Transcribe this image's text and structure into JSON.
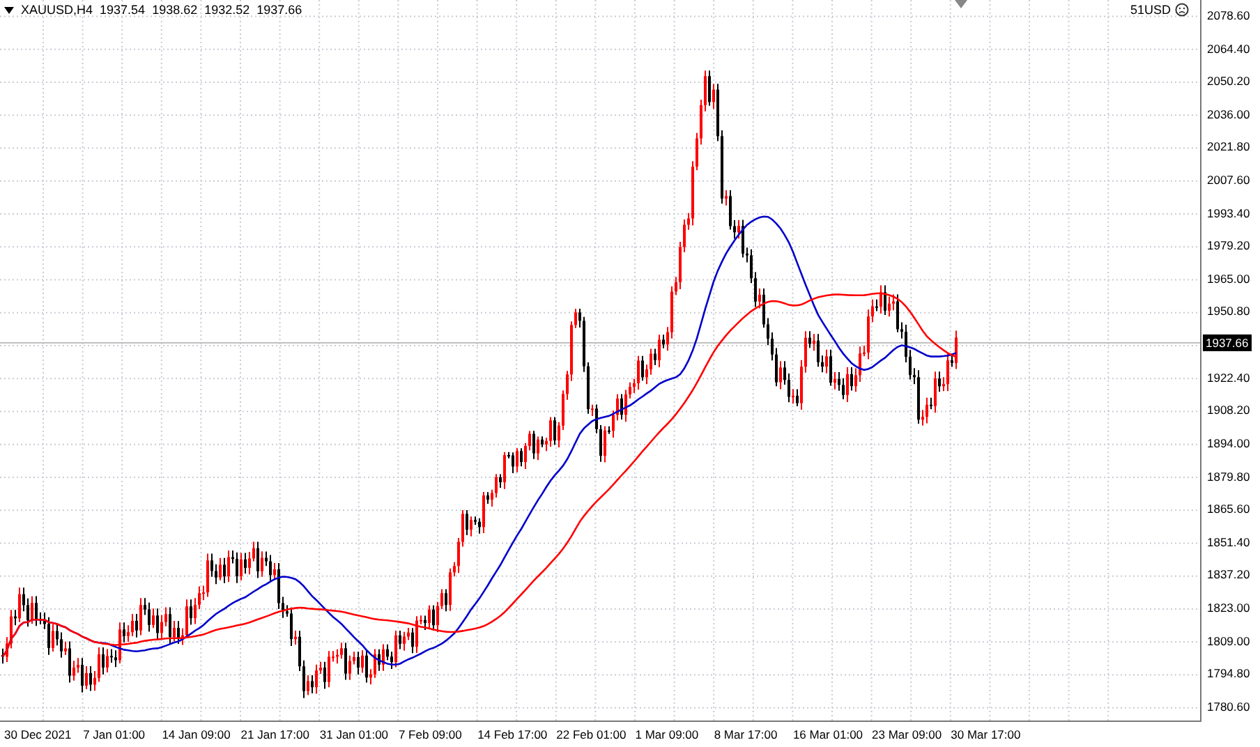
{
  "symbol": "XAUUSD,H4",
  "ohlc": [
    "1937.54",
    "1938.62",
    "1932.52",
    "1937.66"
  ],
  "account": "51USD",
  "price_axis_upper": [
    "2078.60",
    "2064.40",
    "2050.20",
    "2036.00",
    "2021.80",
    "2007.60",
    "1993.40",
    "1979.20",
    "1965.00",
    "1950.80"
  ],
  "price_axis_lower": [
    "1922.40",
    "1908.20",
    "1894.00",
    "1879.80",
    "1865.60",
    "1851.40",
    "1837.20",
    "1823.00",
    "1809.00",
    "1794.80",
    "1780.60"
  ],
  "current_price": "1937.66",
  "time_axis": [
    "30 Dec 2021",
    "7 Jan 01:00",
    "14 Jan 09:00",
    "21 Jan 17:00",
    "31 Jan 01:00",
    "7 Feb 09:00",
    "14 Feb 17:00",
    "22 Feb 01:00",
    "1 Mar 09:00",
    "8 Mar 17:00",
    "16 Mar 01:00",
    "23 Mar 09:00",
    "30 Mar 17:00"
  ]
}
